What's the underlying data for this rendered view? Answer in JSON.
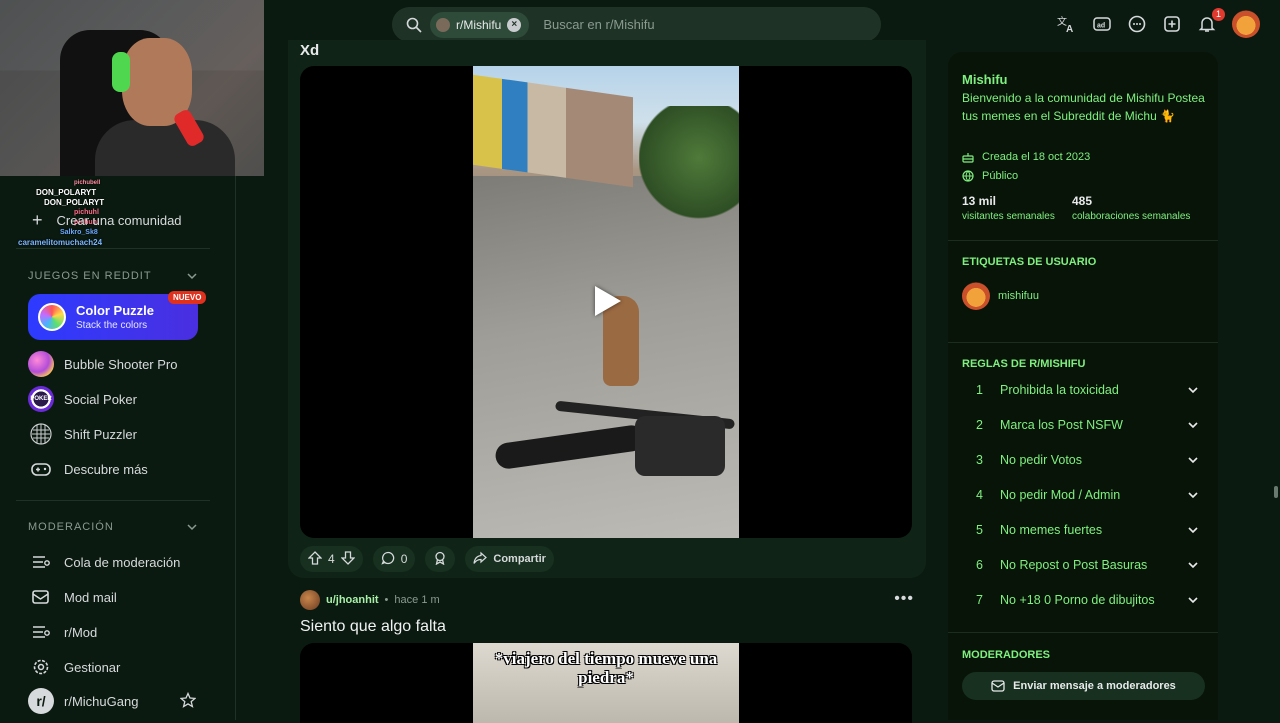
{
  "topbar": {
    "search_chip": "r/Mishifu",
    "search_placeholder": "Buscar en r/Mishifu",
    "notification_count": "1",
    "icons": [
      "translate-icon",
      "advertise-icon",
      "chat-icon",
      "create-post-icon",
      "bell-icon",
      "user-avatar"
    ]
  },
  "sidebar": {
    "chat_names": [
      "pichubell",
      "DON_POLARYT",
      "DON_POLARYT",
      "pichuhl",
      "pichuhl",
      "Salkro_Sk8",
      "caramelitomuchach24"
    ],
    "create_community": "Crear una comunidad",
    "games_header": "JUEGOS EN REDDIT",
    "featured_game": {
      "title": "Color Puzzle",
      "subtitle": "Stack the colors",
      "badge": "NUEVO"
    },
    "games": [
      {
        "label": "Bubble Shooter Pro",
        "icon": "bubble-shooter-icon"
      },
      {
        "label": "Social Poker",
        "icon": "poker-icon"
      },
      {
        "label": "Shift Puzzler",
        "icon": "shift-puzzler-icon"
      },
      {
        "label": "Descubre más",
        "icon": "gamepad-icon"
      }
    ],
    "moderation_header": "MODERACIÓN",
    "moderation": [
      {
        "label": "Cola de moderación",
        "icon": "queue-icon"
      },
      {
        "label": "Mod mail",
        "icon": "mail-icon"
      },
      {
        "label": "r/Mod",
        "icon": "mod-icon"
      },
      {
        "label": "Gestionar",
        "icon": "gear-icon"
      },
      {
        "label": "r/MichuGang",
        "icon": "community-icon"
      }
    ]
  },
  "feed": {
    "post1": {
      "title": "Xd",
      "votes": "4",
      "comments": "0",
      "share_label": "Compartir"
    },
    "post2": {
      "user": "u/jhoanhit",
      "time": "hace 1 m",
      "title": "Siento que algo falta",
      "caption": "*viajero del tiempo mueve una piedra*"
    }
  },
  "right_panel": {
    "title": "Mishifu",
    "description": "Bienvenido a la comunidad de Mishifu Postea tus memes en el Subreddit de Michu 🐈",
    "created": "Creada el 18 oct 2023",
    "visibility": "Público",
    "stats": [
      {
        "value": "13 mil",
        "label": "visitantes semanales"
      },
      {
        "value": "485",
        "label": "colaboraciones semanales"
      }
    ],
    "flair_header": "ETIQUETAS DE USUARIO",
    "flair_user": "mishifuu",
    "rules_header": "REGLAS DE R/MISHIFU",
    "rules": [
      {
        "num": "1",
        "text": "Prohibida la toxicidad"
      },
      {
        "num": "2",
        "text": "Marca los Post NSFW"
      },
      {
        "num": "3",
        "text": "No pedir Votos"
      },
      {
        "num": "4",
        "text": "No pedir Mod / Admin"
      },
      {
        "num": "5",
        "text": "No memes fuertes"
      },
      {
        "num": "6",
        "text": "No Repost o Post Basuras"
      },
      {
        "num": "7",
        "text": "No +18 0 Porno de dibujitos"
      }
    ],
    "moderators_header": "MODERADORES",
    "message_mods": "Enviar mensaje a moderadores"
  },
  "colors": {
    "background": "#0b1a10",
    "accent_green": "#7ef07e",
    "notification_red": "#e03a2f",
    "game_card_blue": "#2d3bff"
  }
}
